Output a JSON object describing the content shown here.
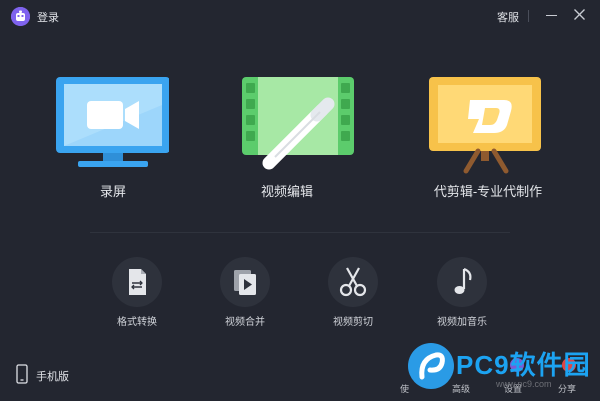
{
  "titlebar": {
    "login_label": "登录",
    "support_label": "客服"
  },
  "features": [
    {
      "label": "录屏",
      "icon": "monitor-video-icon",
      "color": "#3aa4f0"
    },
    {
      "label": "视频编辑",
      "icon": "film-pen-icon",
      "color": "#5ccc6c"
    },
    {
      "label": "代剪辑-专业代制作",
      "icon": "easel-logo-icon",
      "color": "#f7c24a"
    }
  ],
  "tools": [
    {
      "label": "格式转换",
      "icon": "file-convert-icon"
    },
    {
      "label": "视频合并",
      "icon": "video-merge-icon"
    },
    {
      "label": "视频剪切",
      "icon": "scissors-icon"
    },
    {
      "label": "视频加音乐",
      "icon": "music-note-icon"
    }
  ],
  "footer": {
    "mobile_label": "手机版"
  },
  "watermark": {
    "brand": "PC9软件园",
    "url": "www.pc9.com"
  },
  "bottom_strip": [
    "使",
    "高级",
    "设置",
    "分享"
  ]
}
